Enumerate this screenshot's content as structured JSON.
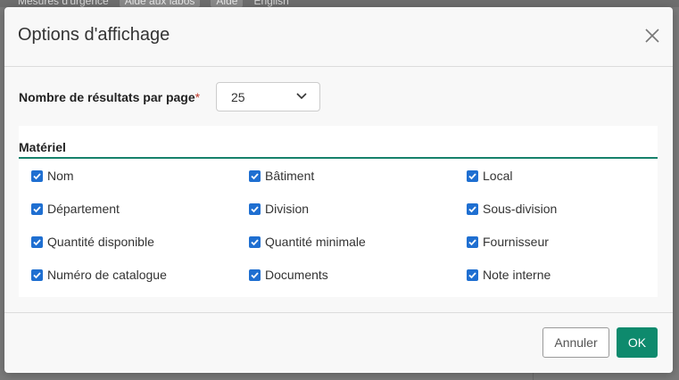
{
  "background": {
    "menu_items": [
      "Mesures d'urgence",
      "Aide aux labos",
      "Aide",
      "English"
    ]
  },
  "dialog": {
    "title": "Options d'affichage",
    "close_icon": "close-icon",
    "results_per_page": {
      "label": "Nombre de résultats par page",
      "required_marker": "*",
      "value": "25",
      "chevron_icon": "chevron-down-icon"
    },
    "section": {
      "title": "Matériel",
      "fields": [
        {
          "label": "Nom",
          "checked": true
        },
        {
          "label": "Bâtiment",
          "checked": true
        },
        {
          "label": "Local",
          "checked": true
        },
        {
          "label": "Département",
          "checked": true
        },
        {
          "label": "Division",
          "checked": true
        },
        {
          "label": "Sous-division",
          "checked": true
        },
        {
          "label": "Quantité disponible",
          "checked": true
        },
        {
          "label": "Quantité minimale",
          "checked": true
        },
        {
          "label": "Fournisseur",
          "checked": true
        },
        {
          "label": "Numéro de catalogue",
          "checked": true
        },
        {
          "label": "Documents",
          "checked": true
        },
        {
          "label": "Note interne",
          "checked": true
        }
      ]
    },
    "buttons": {
      "cancel": "Annuler",
      "ok": "OK"
    }
  },
  "colors": {
    "accent": "#0e8a6d",
    "checkbox": "#1f6fd1",
    "required": "#c0392b"
  }
}
